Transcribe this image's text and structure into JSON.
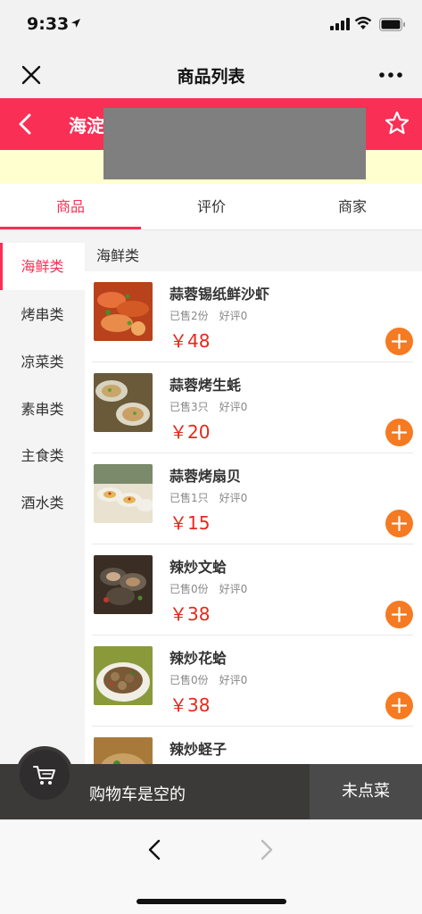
{
  "status_bar": {
    "time": "9:33"
  },
  "nav": {
    "title": "商品列表"
  },
  "shop": {
    "name": "海淀"
  },
  "tabs": [
    {
      "label": "商品"
    },
    {
      "label": "评价"
    },
    {
      "label": "商家"
    }
  ],
  "categories": [
    {
      "label": "海鲜类"
    },
    {
      "label": "烤串类"
    },
    {
      "label": "凉菜类"
    },
    {
      "label": "素串类"
    },
    {
      "label": "主食类"
    },
    {
      "label": "酒水类"
    }
  ],
  "section_title": "海鲜类",
  "products": [
    {
      "name": "蒜蓉锡纸鲜沙虾",
      "sold": "已售2份",
      "rating": "好评0",
      "price": "￥48"
    },
    {
      "name": "蒜蓉烤生蚝",
      "sold": "已售3只",
      "rating": "好评0",
      "price": "￥20"
    },
    {
      "name": "蒜蓉烤扇贝",
      "sold": "已售1只",
      "rating": "好评0",
      "price": "￥15"
    },
    {
      "name": "辣炒文蛤",
      "sold": "已售0份",
      "rating": "好评0",
      "price": "￥38"
    },
    {
      "name": "辣炒花蛤",
      "sold": "已售0份",
      "rating": "好评0",
      "price": "￥38"
    },
    {
      "name": "辣炒蛏子",
      "sold": "",
      "rating": "",
      "price": ""
    }
  ],
  "cart": {
    "status": "购物车是空的",
    "order_button": "未点菜"
  },
  "colors": {
    "accent": "#fa2f55",
    "price": "#e8271b",
    "add_button": "#f57a22"
  }
}
